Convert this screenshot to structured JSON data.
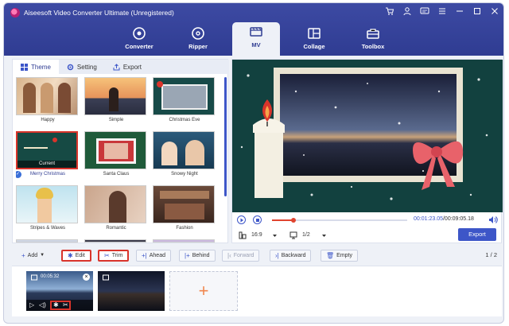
{
  "window": {
    "title": "Aiseesoft Video Converter Ultimate (Unregistered)"
  },
  "nav": {
    "items": [
      {
        "label": "Converter"
      },
      {
        "label": "Ripper"
      },
      {
        "label": "MV",
        "active": true
      },
      {
        "label": "Collage"
      },
      {
        "label": "Toolbox"
      }
    ]
  },
  "left_tabs": {
    "theme": "Theme",
    "setting": "Setting",
    "export": "Export"
  },
  "themes": [
    {
      "label": "Happy"
    },
    {
      "label": "Simple"
    },
    {
      "label": "Christmas Eve"
    },
    {
      "label": "Merry Christmas",
      "current": true,
      "badge": "Current"
    },
    {
      "label": "Santa Claus"
    },
    {
      "label": "Snowy Night"
    },
    {
      "label": "Stripes & Waves"
    },
    {
      "label": "Romantic"
    },
    {
      "label": "Fashion"
    }
  ],
  "player": {
    "time_current": "00:01:23.05",
    "time_total": "/00:09:05.18",
    "progress_fraction": 0.16,
    "aspect": "16:9",
    "screen": "1/2",
    "export_label": "Export"
  },
  "toolbar": {
    "add": "Add",
    "edit": "Edit",
    "trim": "Trim",
    "ahead": "Ahead",
    "behind": "Behind",
    "forward": "Forward",
    "backward": "Backward",
    "empty": "Empty",
    "page": "1 / 2"
  },
  "timeline": {
    "clip1_time": "00:05:32",
    "add_symbol": "+"
  },
  "colors": {
    "brand": "#2f3c92",
    "accent": "#3d56c8",
    "highlight": "#d9342b"
  }
}
